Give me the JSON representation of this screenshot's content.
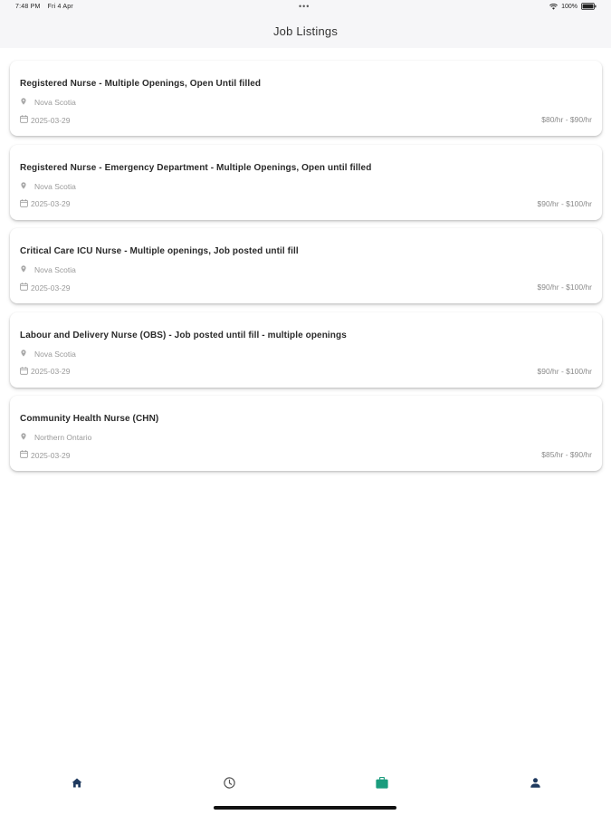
{
  "status_bar": {
    "time": "7:48 PM",
    "date": "Fri 4 Apr",
    "dots": "•••",
    "battery": "100%"
  },
  "app_bar": {
    "title": "Job Listings"
  },
  "jobs": [
    {
      "title": "Registered Nurse - Multiple Openings, Open Until filled",
      "location": "Nova Scotia",
      "date": "2025-03-29",
      "pay": "$80/hr - $90/hr"
    },
    {
      "title": "Registered Nurse - Emergency Department - Multiple Openings, Open until filled",
      "location": "Nova Scotia",
      "date": "2025-03-29",
      "pay": "$90/hr - $100/hr"
    },
    {
      "title": "Critical Care ICU Nurse - Multiple openings, Job posted until fill",
      "location": "Nova Scotia",
      "date": "2025-03-29",
      "pay": "$90/hr - $100/hr"
    },
    {
      "title": "Labour and Delivery Nurse (OBS) - Job posted until fill - multiple openings",
      "location": "Nova Scotia",
      "date": "2025-03-29",
      "pay": "$90/hr - $100/hr"
    },
    {
      "title": "Community Health Nurse (CHN)",
      "location": "Northern Ontario",
      "date": "2025-03-29",
      "pay": "$85/hr - $90/hr"
    }
  ],
  "bottom_nav": {
    "items": [
      {
        "icon": "home-icon",
        "color": "#1f3a5f"
      },
      {
        "icon": "clock-icon",
        "color": "#555555"
      },
      {
        "icon": "briefcase-icon",
        "color": "#1a9c7d",
        "active": true
      },
      {
        "icon": "person-icon",
        "color": "#1f3a5f"
      }
    ]
  },
  "colors": {
    "primary_navy": "#1f3a5f",
    "active_green": "#1a9c7d",
    "muted_text": "#9a9a9a"
  }
}
